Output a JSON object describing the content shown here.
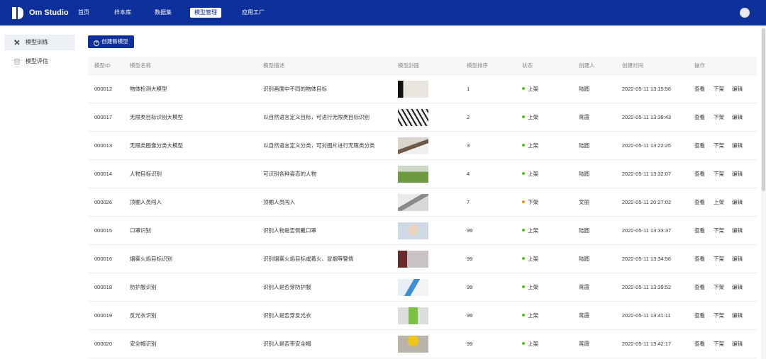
{
  "app": {
    "name": "Om Studio"
  },
  "nav": {
    "items": [
      "首页",
      "样本库",
      "数据集",
      "模型管理",
      "应用工厂"
    ],
    "active_index": 3
  },
  "sidebar": {
    "items": [
      {
        "label": "模型训练",
        "icon": "tools-icon",
        "active": true
      },
      {
        "label": "模型评估",
        "icon": "document-icon",
        "active": false
      }
    ]
  },
  "toolbar": {
    "create_label": "创建新模型"
  },
  "table": {
    "columns": [
      "模型ID",
      "模型名称",
      "模型描述",
      "模型封面",
      "模型排序",
      "状态",
      "创建人",
      "创建时间",
      "操作"
    ],
    "rows": [
      {
        "id": "000012",
        "name": "物体检测大模型",
        "desc": "识别画面中不同的物体目标",
        "rank": "1",
        "status": "上架",
        "creator": "陆圆",
        "time": "2022-05-11 13:15:56",
        "ops": [
          "查看",
          "下架",
          "编辑"
        ],
        "thumb": "objects"
      },
      {
        "id": "000017",
        "name": "无限类目标识别大模型",
        "desc": "以自然语言定义目标，可进行无限类目标识别",
        "rank": "2",
        "status": "上架",
        "creator": "蒋霞",
        "time": "2022-05-11 13:38:43",
        "ops": [
          "查看",
          "下架",
          "编辑"
        ],
        "thumb": "tools"
      },
      {
        "id": "000013",
        "name": "无限类图像分类大模型",
        "desc": "以自然语言定义分类，可对图片进行无限类分类",
        "rank": "3",
        "status": "上架",
        "creator": "陆圆",
        "time": "2022-05-11 13:22:25",
        "ops": [
          "查看",
          "下架",
          "编辑"
        ],
        "thumb": "desk"
      },
      {
        "id": "000014",
        "name": "人物目标识别",
        "desc": "可识别各种姿态的人物",
        "rank": "4",
        "status": "上架",
        "creator": "陆圆",
        "time": "2022-05-11 13:32:07",
        "ops": [
          "查看",
          "下架",
          "编辑"
        ],
        "thumb": "field"
      },
      {
        "id": "000026",
        "name": "顶棚人员闯入",
        "desc": "顶棚人员闯入",
        "rank": "7",
        "status": "下架",
        "creator": "文丽",
        "time": "2022-05-11 20:27:02",
        "ops": [
          "查看",
          "上架",
          "编辑"
        ],
        "thumb": "roof"
      },
      {
        "id": "000015",
        "name": "口罩识别",
        "desc": "识别人物是否佩戴口罩",
        "rank": "99",
        "status": "上架",
        "creator": "陆圆",
        "time": "2022-05-11 13:33:37",
        "ops": [
          "查看",
          "下架",
          "编辑"
        ],
        "thumb": "mask"
      },
      {
        "id": "000016",
        "name": "烟雾火焰目标识别",
        "desc": "识别烟雾火焰目标或着火、冒烟等警情",
        "rank": "99",
        "status": "上架",
        "creator": "陆圆",
        "time": "2022-05-11 13:34:56",
        "ops": [
          "查看",
          "下架",
          "编辑"
        ],
        "thumb": "smoke"
      },
      {
        "id": "000018",
        "name": "防护服识别",
        "desc": "识别人是否穿防护服",
        "rank": "99",
        "status": "上架",
        "creator": "蒋霞",
        "time": "2022-05-11 13:39:52",
        "ops": [
          "查看",
          "下架",
          "编辑"
        ],
        "thumb": "suit"
      },
      {
        "id": "000019",
        "name": "反光衣识别",
        "desc": "识别人是否穿反光衣",
        "rank": "99",
        "status": "上架",
        "creator": "蒋霞",
        "time": "2022-05-11 13:41:11",
        "ops": [
          "查看",
          "下架",
          "编辑"
        ],
        "thumb": "vest"
      },
      {
        "id": "000020",
        "name": "安全帽识别",
        "desc": "识别人是否带安全帽",
        "rank": "99",
        "status": "上架",
        "creator": "蒋霞",
        "time": "2022-05-11 13:42:17",
        "ops": [
          "查看",
          "下架",
          "编辑"
        ],
        "thumb": "helmet"
      }
    ]
  },
  "colors": {
    "brand": "#0d2f9c",
    "status_on": "#52c41a",
    "status_off": "#fa8c16"
  }
}
